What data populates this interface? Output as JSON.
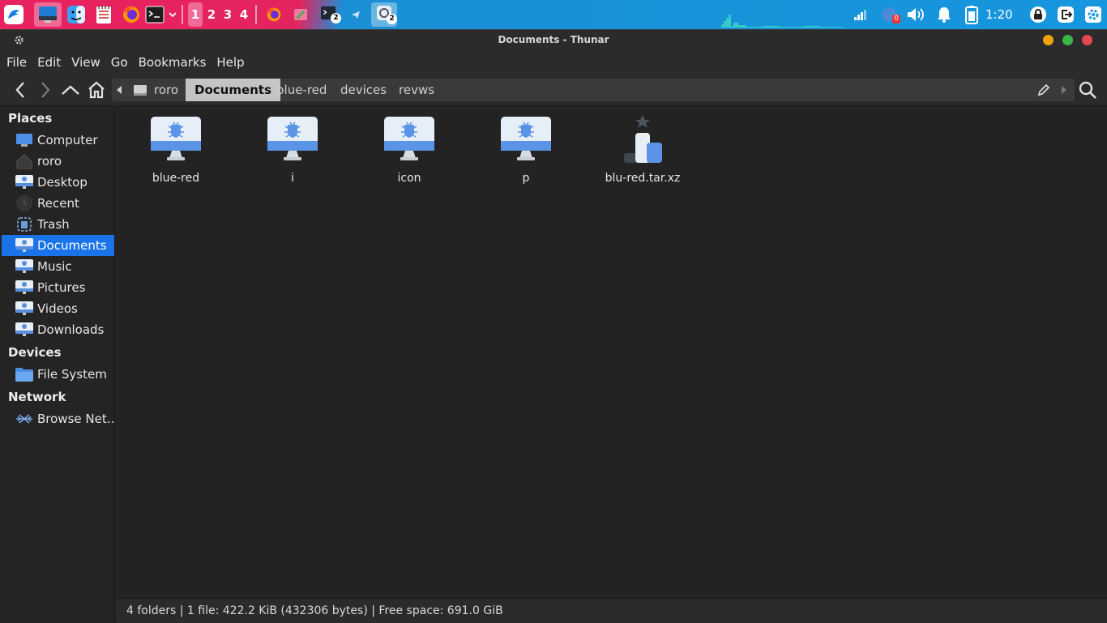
{
  "panel": {
    "workspaces": [
      "1",
      "2",
      "3",
      "4"
    ],
    "active_workspace": "1",
    "terminal_badge": "2",
    "files_badge": "2",
    "notification_count": "0",
    "clock": "1:20"
  },
  "window": {
    "title": "Documents - Thunar"
  },
  "menu": [
    "File",
    "Edit",
    "View",
    "Go",
    "Bookmarks",
    "Help"
  ],
  "path": {
    "crumbs": [
      "roro",
      "Documents",
      "blue-red",
      "devices",
      "revws"
    ],
    "active": "Documents"
  },
  "sidebar": {
    "places_header": "Places",
    "places": [
      "Computer",
      "roro",
      "Desktop",
      "Recent",
      "Trash",
      "Documents",
      "Music",
      "Pictures",
      "Videos",
      "Downloads"
    ],
    "selected": "Documents",
    "devices_header": "Devices",
    "devices": [
      "File System"
    ],
    "network_header": "Network",
    "network": [
      "Browse Net…"
    ]
  },
  "files": [
    {
      "name": "blue-red",
      "kind": "folder"
    },
    {
      "name": "i",
      "kind": "folder"
    },
    {
      "name": "icon",
      "kind": "folder"
    },
    {
      "name": "p",
      "kind": "folder"
    },
    {
      "name": "blu-red.tar.xz",
      "kind": "archive"
    }
  ],
  "status": "4 folders  |  1 file: 422.2 KiB (432306 bytes)  |  Free space: 691.0 GiB",
  "colors": {
    "accent": "#1a73e8",
    "panel_pink": "#e4245f",
    "panel_blue": "#1596de"
  }
}
